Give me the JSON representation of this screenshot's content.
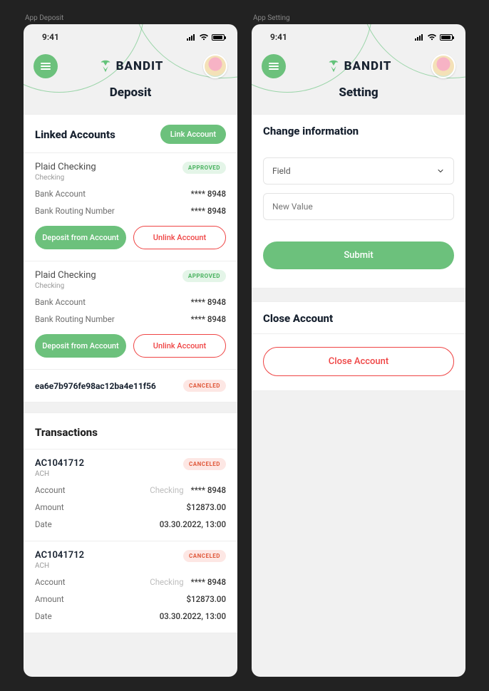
{
  "shared": {
    "status_time": "9:41",
    "brand": "BANDIT"
  },
  "deposit": {
    "frame_label": "App Deposit",
    "page_title": "Deposit",
    "linked_accounts": {
      "title": "Linked Accounts",
      "link_button": "Link Account",
      "accounts": [
        {
          "name": "Plaid Checking",
          "subtype": "Checking",
          "status": "APPROVED",
          "status_kind": "approved",
          "bank_account_label": "Bank Account",
          "bank_account_value": "**** 8948",
          "routing_label": "Bank Routing Number",
          "routing_value": "**** 8948",
          "deposit_btn": "Deposit from Account",
          "unlink_btn": "Unlink Account"
        },
        {
          "name": "Plaid Checking",
          "subtype": "Checking",
          "status": "APPROVED",
          "status_kind": "approved",
          "bank_account_label": "Bank Account",
          "bank_account_value": "**** 8948",
          "routing_label": "Bank Routing Number",
          "routing_value": "**** 8948",
          "deposit_btn": "Deposit from Account",
          "unlink_btn": "Unlink Account"
        }
      ],
      "hash_row": {
        "hash": "ea6e7b976fe98ac12ba4e11f56",
        "status": "CANCELED",
        "status_kind": "canceled"
      }
    },
    "transactions": {
      "title": "Transactions",
      "items": [
        {
          "ref": "AC1041712",
          "type": "ACH",
          "status": "CANCELED",
          "status_kind": "canceled",
          "account_label": "Account",
          "account_type": "Checking",
          "account_value": "**** 8948",
          "amount_label": "Amount",
          "amount_value": "$12873.00",
          "date_label": "Date",
          "date_value": "03.30.2022, 13:00"
        },
        {
          "ref": "AC1041712",
          "type": "ACH",
          "status": "CANCELED",
          "status_kind": "canceled",
          "account_label": "Account",
          "account_type": "Checking",
          "account_value": "**** 8948",
          "amount_label": "Amount",
          "amount_value": "$12873.00",
          "date_label": "Date",
          "date_value": "03.30.2022, 13:00"
        }
      ]
    }
  },
  "setting": {
    "frame_label": "App Setting",
    "page_title": "Setting",
    "change_info": {
      "title": "Change information",
      "field_label": "Field",
      "new_value_placeholder": "New Value",
      "submit_label": "Submit"
    },
    "close_account": {
      "title": "Close Account",
      "button_label": "Close Account"
    }
  }
}
